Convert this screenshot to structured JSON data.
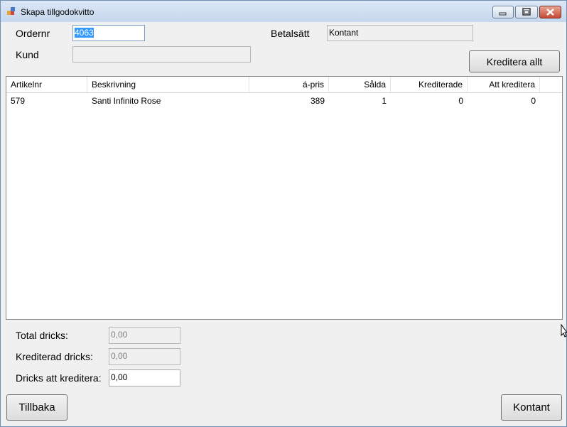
{
  "window": {
    "title": "Skapa tillgodokvitto"
  },
  "form": {
    "ordernr_label": "Ordernr",
    "ordernr_value": "4063",
    "kund_label": "Kund",
    "kund_value": "",
    "betalsatt_label": "Betalsätt",
    "betalsatt_value": "Kontant",
    "kreditera_allt_label": "Kreditera allt"
  },
  "table": {
    "columns": [
      "Artikelnr",
      "Beskrivning",
      "á-pris",
      "Sålda",
      "Krediterade",
      "Att kreditera"
    ],
    "rows": [
      [
        "579",
        "Santi Infinito Rose",
        "389",
        "1",
        "0",
        "0"
      ]
    ]
  },
  "totals": {
    "total_dricks_label": "Total dricks:",
    "total_dricks_value": "0,00",
    "krediterad_dricks_label": "Krediterad dricks:",
    "krediterad_dricks_value": "0,00",
    "dricks_att_kreditera_label": "Dricks att kreditera:",
    "dricks_att_kreditera_value": "0,00"
  },
  "buttons": {
    "tillbaka": "Tillbaka",
    "kontant": "Kontant"
  }
}
